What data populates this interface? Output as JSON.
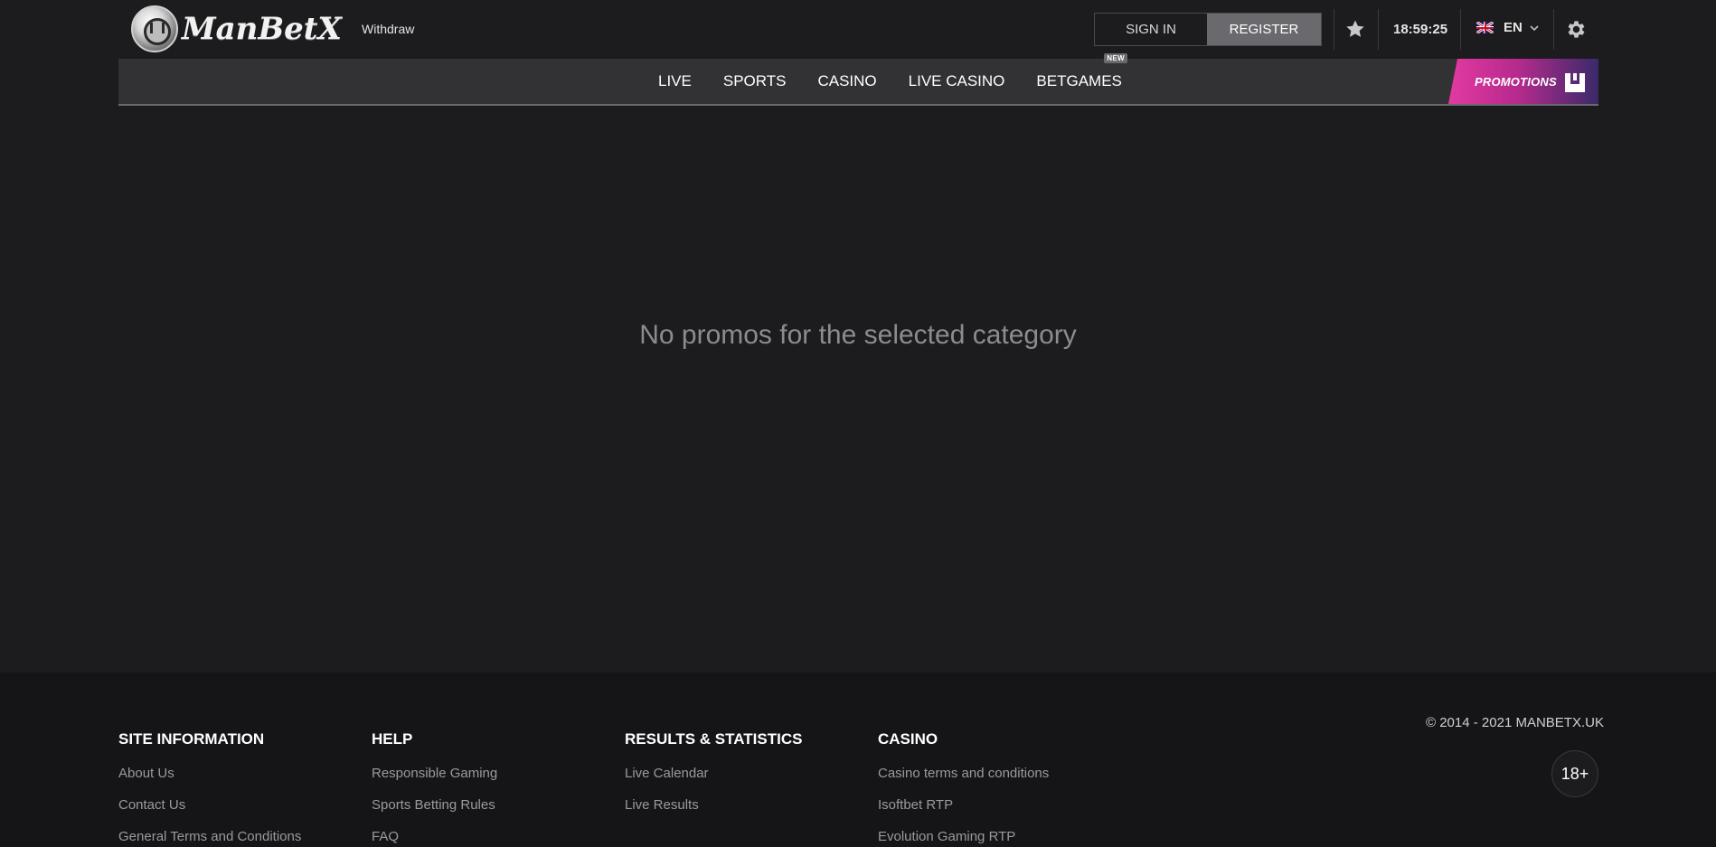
{
  "header": {
    "brand": "ManBetX",
    "withdraw_label": "Withdraw",
    "signin_label": "SIGN IN",
    "register_label": "REGISTER",
    "clock": "18:59:25",
    "language": "EN",
    "favorites_icon": "star-icon",
    "settings_icon": "gear-icon",
    "language_flag": "uk-flag-icon"
  },
  "nav": {
    "items": [
      {
        "label": "LIVE"
      },
      {
        "label": "SPORTS"
      },
      {
        "label": "CASINO"
      },
      {
        "label": "LIVE CASINO"
      },
      {
        "label": "BETGAMES",
        "badge": "NEW"
      }
    ],
    "promotions_label": "PROMOTIONS"
  },
  "main": {
    "empty_message": "No promos for the selected category"
  },
  "footer": {
    "columns": [
      {
        "title": "SITE INFORMATION",
        "links": [
          "About Us",
          "Contact Us",
          "General Terms and Conditions"
        ]
      },
      {
        "title": "HELP",
        "links": [
          "Responsible Gaming",
          "Sports Betting Rules",
          "FAQ"
        ]
      },
      {
        "title": "RESULTS & STATISTICS",
        "links": [
          "Live Calendar",
          "Live Results"
        ]
      },
      {
        "title": "CASINO",
        "links": [
          "Casino terms and conditions",
          "Isoftbet RTP",
          "Evolution Gaming RTP"
        ]
      }
    ],
    "copyright": "© 2014 - 2021 MANBETX.UK",
    "age_badge": "18+"
  },
  "colors": {
    "background": "#1c1c1e",
    "navbar": "#323234",
    "register_button": "#6a6a6e",
    "promo_gradient_start": "#e23aa0",
    "promo_gradient_end": "#3a2a6a",
    "footer": "#151517"
  }
}
